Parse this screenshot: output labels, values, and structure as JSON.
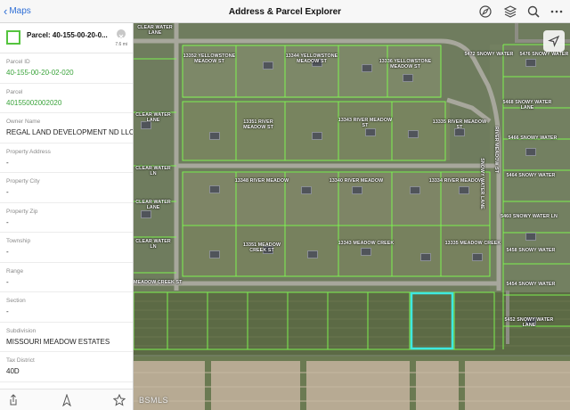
{
  "app": {
    "title": "Address & Parcel Explorer",
    "back_label": "Maps"
  },
  "toolbar_icons": [
    "compass-icon",
    "layers-icon",
    "search-icon",
    "more-icon"
  ],
  "panel": {
    "title": "Parcel: 40-155-00-20-0...",
    "distance": "7.6 mi",
    "fields": [
      {
        "label": "Parcel ID",
        "value": "40-155-00-20-02-020",
        "green": true
      },
      {
        "label": "Parcel",
        "value": "40155002002020",
        "green": true
      },
      {
        "label": "Owner Name",
        "value": "REGAL LAND DEVELOPMENT ND LLC"
      },
      {
        "label": "Property Address",
        "value": "-"
      },
      {
        "label": "Property City",
        "value": "-"
      },
      {
        "label": "Property Zip",
        "value": "-"
      },
      {
        "label": "Township",
        "value": "-"
      },
      {
        "label": "Range",
        "value": "-"
      },
      {
        "label": "Section",
        "value": "-"
      },
      {
        "label": "Subdivision",
        "value": "MISSOURI MEADOW ESTATES"
      },
      {
        "label": "Tax District",
        "value": "40D"
      }
    ]
  },
  "map": {
    "labels": [
      "CLEAR WATER LANE",
      "13352 YELLOWSTONE MEADOW ST",
      "13344 YELLOWSTONE MEADOW ST",
      "13336 YELLOWSTONE MEADOW ST",
      "5472 SNOWY WATER",
      "5476 SNOWY WATER",
      "CLEAR WATER LANE",
      "13351 RIVER MEADOW ST",
      "13343 RIVER MEADOW ST",
      "13335 RIVER MEADOW ST",
      "5468 SNOWY WATER LANE",
      "5466 SNOWY WATER",
      "CLEAR WATER LN",
      "13348 RIVER MEADOW",
      "13340 RIVER MEADOW",
      "13334 RIVER MEADOW",
      "5464 SNOWY WATER",
      "CLEAR WATER LANE",
      "5460 SNOWY WATER LN",
      "13351 MEADOW CREEK ST",
      "13343 MEADOW CREEK",
      "13335 MEADOW CREEK",
      "CLEAR WATER LN",
      "5458 SNOWY WATER",
      "MEADOW CREEK ST",
      "5454 SNOWY WATER",
      "5452 SNOWY WATER LANE",
      "SNOWY WATER LANE",
      "RIVER MEADOW ST"
    ],
    "watermark": "BSMLS"
  },
  "colors": {
    "parcel_line": "#7fff4f",
    "selected_parcel": "#3ee8e0",
    "link": "#2f6fd6"
  }
}
